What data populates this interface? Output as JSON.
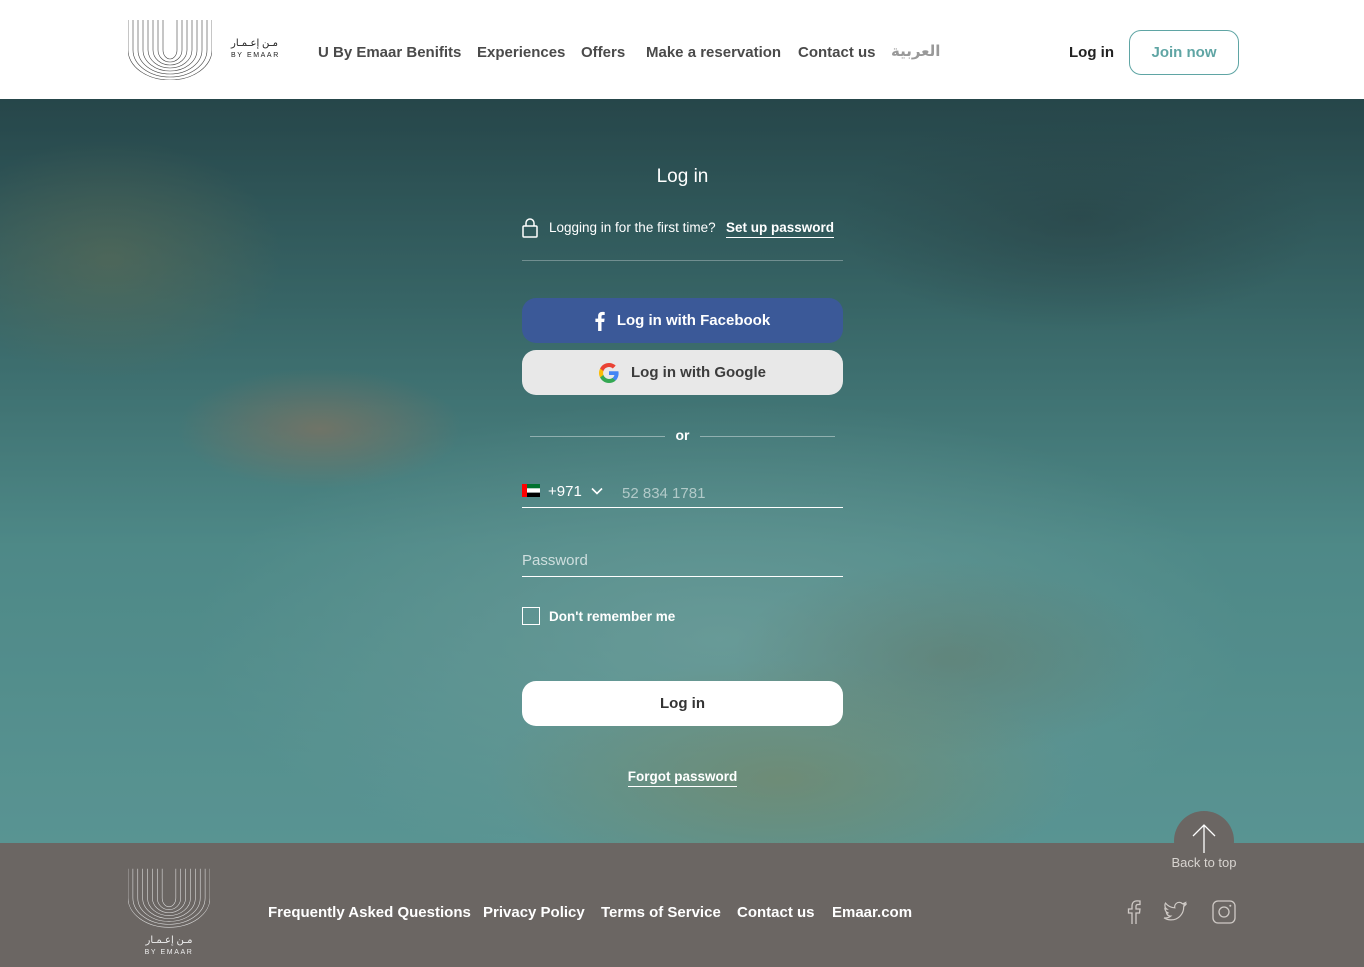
{
  "header": {
    "logo": {
      "arabic": "مـن إعـمـار",
      "english": "BY EMAAR"
    },
    "nav": [
      {
        "label": "U By Emaar Benifits"
      },
      {
        "label": "Experiences"
      },
      {
        "label": "Offers"
      },
      {
        "label": "Make a reservation"
      },
      {
        "label": "Contact us"
      },
      {
        "label": "العربية"
      }
    ],
    "login_label": "Log in",
    "join_label": "Join now"
  },
  "login_form": {
    "title": "Log in",
    "first_time_text": "Logging in for the first time?",
    "setup_password_label": "Set up password",
    "facebook_label": "Log in with Facebook",
    "google_label": "Log in with Google",
    "or_text": "or",
    "country_code": "+971",
    "phone_placeholder": "52 834 1781",
    "password_placeholder": "Password",
    "remember_label": "Don't remember me",
    "remember_checked": false,
    "submit_label": "Log in",
    "forgot_label": "Forgot password"
  },
  "footer": {
    "logo": {
      "arabic": "مـن إعـمـار",
      "english": "BY EMAAR"
    },
    "links": [
      {
        "label": "Frequently Asked Questions"
      },
      {
        "label": "Privacy Policy"
      },
      {
        "label": "Terms of Service"
      },
      {
        "label": "Contact us"
      },
      {
        "label": "Emaar.com"
      }
    ],
    "back_to_top_label": "Back to top",
    "social": [
      {
        "icon": "facebook-icon"
      },
      {
        "icon": "twitter-icon"
      },
      {
        "icon": "instagram-icon"
      }
    ]
  },
  "colors": {
    "accent": "#5fa5a4",
    "facebook": "#3b5998",
    "footer_bg": "#6b6663"
  }
}
